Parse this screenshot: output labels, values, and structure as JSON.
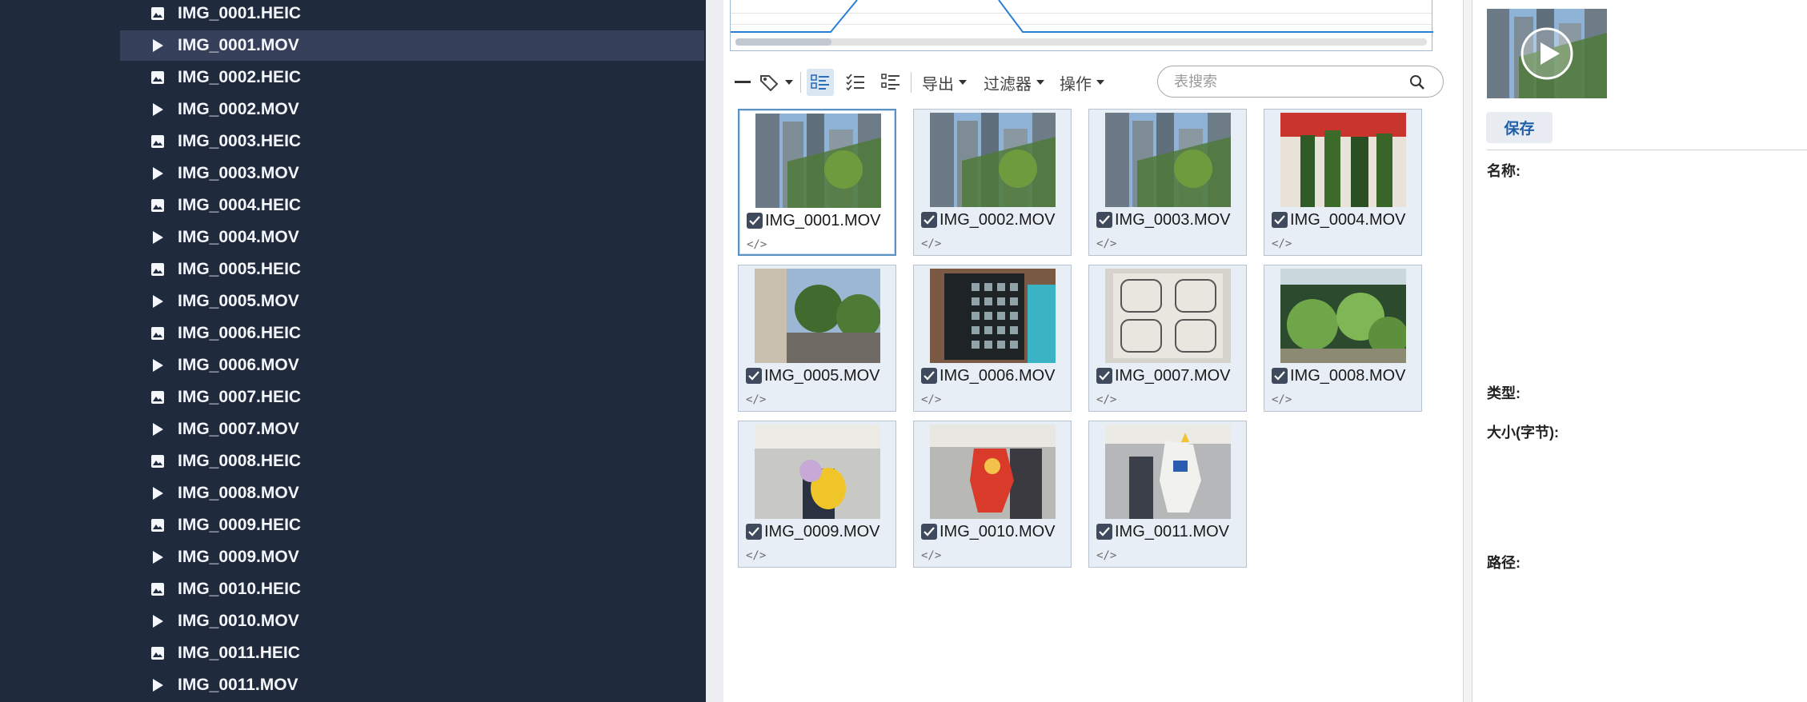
{
  "sidebar": {
    "items": [
      {
        "label": "IMG_0001.HEIC",
        "kind": "image",
        "icon": "image-icon"
      },
      {
        "label": "IMG_0001.MOV",
        "kind": "video",
        "icon": "play-icon",
        "selected": true
      },
      {
        "label": "IMG_0002.HEIC",
        "kind": "image",
        "icon": "image-icon"
      },
      {
        "label": "IMG_0002.MOV",
        "kind": "video",
        "icon": "play-icon"
      },
      {
        "label": "IMG_0003.HEIC",
        "kind": "image",
        "icon": "image-icon"
      },
      {
        "label": "IMG_0003.MOV",
        "kind": "video",
        "icon": "play-icon"
      },
      {
        "label": "IMG_0004.HEIC",
        "kind": "image",
        "icon": "image-icon"
      },
      {
        "label": "IMG_0004.MOV",
        "kind": "video",
        "icon": "play-icon"
      },
      {
        "label": "IMG_0005.HEIC",
        "kind": "image",
        "icon": "image-icon"
      },
      {
        "label": "IMG_0005.MOV",
        "kind": "video",
        "icon": "play-icon"
      },
      {
        "label": "IMG_0006.HEIC",
        "kind": "image",
        "icon": "image-icon"
      },
      {
        "label": "IMG_0006.MOV",
        "kind": "video",
        "icon": "play-icon"
      },
      {
        "label": "IMG_0007.HEIC",
        "kind": "image",
        "icon": "image-icon"
      },
      {
        "label": "IMG_0007.MOV",
        "kind": "video",
        "icon": "play-icon"
      },
      {
        "label": "IMG_0008.HEIC",
        "kind": "image",
        "icon": "image-icon"
      },
      {
        "label": "IMG_0008.MOV",
        "kind": "video",
        "icon": "play-icon"
      },
      {
        "label": "IMG_0009.HEIC",
        "kind": "image",
        "icon": "image-icon"
      },
      {
        "label": "IMG_0009.MOV",
        "kind": "video",
        "icon": "play-icon"
      },
      {
        "label": "IMG_0010.HEIC",
        "kind": "image",
        "icon": "image-icon"
      },
      {
        "label": "IMG_0010.MOV",
        "kind": "video",
        "icon": "play-icon"
      },
      {
        "label": "IMG_0011.HEIC",
        "kind": "image",
        "icon": "image-icon"
      },
      {
        "label": "IMG_0011.MOV",
        "kind": "video",
        "icon": "play-icon"
      }
    ]
  },
  "toolbar": {
    "export_label": "导出",
    "filter_label": "过滤器",
    "actions_label": "操作",
    "search_placeholder": "表搜索"
  },
  "grid": {
    "items": [
      {
        "name": "IMG_0001.MOV",
        "checked": true,
        "selected": true,
        "code": "</>",
        "thumb": "city-towers"
      },
      {
        "name": "IMG_0002.MOV",
        "checked": true,
        "code": "</>",
        "thumb": "city-towers"
      },
      {
        "name": "IMG_0003.MOV",
        "checked": true,
        "code": "</>",
        "thumb": "city-towers"
      },
      {
        "name": "IMG_0004.MOV",
        "checked": true,
        "code": "</>",
        "thumb": "hedge-wall"
      },
      {
        "name": "IMG_0005.MOV",
        "checked": true,
        "code": "</>",
        "thumb": "street-trees"
      },
      {
        "name": "IMG_0006.MOV",
        "checked": true,
        "code": "</>",
        "thumb": "menu-board"
      },
      {
        "name": "IMG_0007.MOV",
        "checked": true,
        "code": "</>",
        "thumb": "menu-paper"
      },
      {
        "name": "IMG_0008.MOV",
        "checked": true,
        "code": "</>",
        "thumb": "aquarium"
      },
      {
        "name": "IMG_0009.MOV",
        "checked": true,
        "code": "</>",
        "thumb": "figure-yellow"
      },
      {
        "name": "IMG_0010.MOV",
        "checked": true,
        "code": "</>",
        "thumb": "figure-red"
      },
      {
        "name": "IMG_0011.MOV",
        "checked": true,
        "code": "</>",
        "thumb": "figure-white"
      }
    ]
  },
  "details": {
    "save_label": "保存",
    "name_label": "名称:",
    "type_label": "类型:",
    "size_label": "大小(字节):",
    "path_label": "路径:"
  },
  "colors": {
    "sidebar_bg": "#1f2a3c",
    "sidebar_selected": "#36405a",
    "accent": "#1f5fa8",
    "card_bg": "#e8eef6"
  }
}
